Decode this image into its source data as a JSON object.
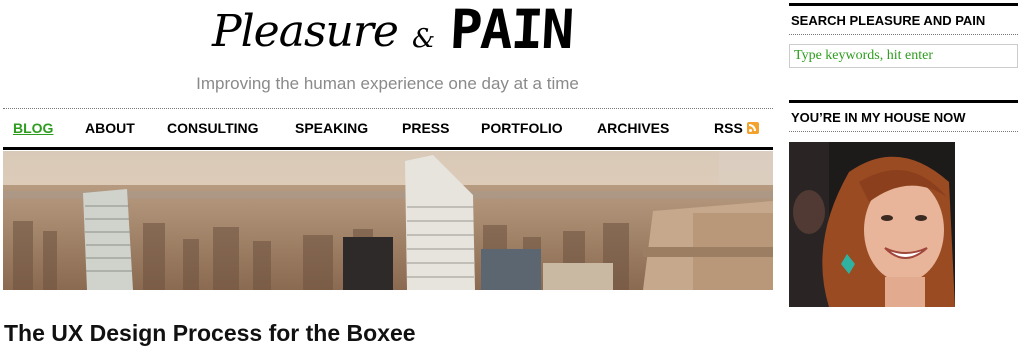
{
  "header": {
    "logo_script": "Pleasure",
    "logo_amp": "&",
    "logo_pain": "PAIN",
    "tagline": "Improving the human experience one day at a time"
  },
  "nav": {
    "items": [
      {
        "label": "Blog",
        "active": true
      },
      {
        "label": "About"
      },
      {
        "label": "Consulting"
      },
      {
        "label": "Speaking"
      },
      {
        "label": "Press"
      },
      {
        "label": "Portfolio"
      },
      {
        "label": "Archives"
      },
      {
        "label": "RSS",
        "icon": "rss-icon"
      }
    ]
  },
  "banner": {
    "image": "new-york-skyline-photo"
  },
  "post": {
    "title": "The UX Design Process for the Boxee"
  },
  "sidebar": {
    "search_heading": "Search Pleasure and Pain",
    "search_placeholder": "Type keywords, hit enter",
    "house_heading": "You’re in my house now",
    "photo": "author-photo"
  },
  "colors": {
    "accent": "#2e9c1f",
    "tagline": "#8a8a8a",
    "rss": "#f3a22d"
  }
}
